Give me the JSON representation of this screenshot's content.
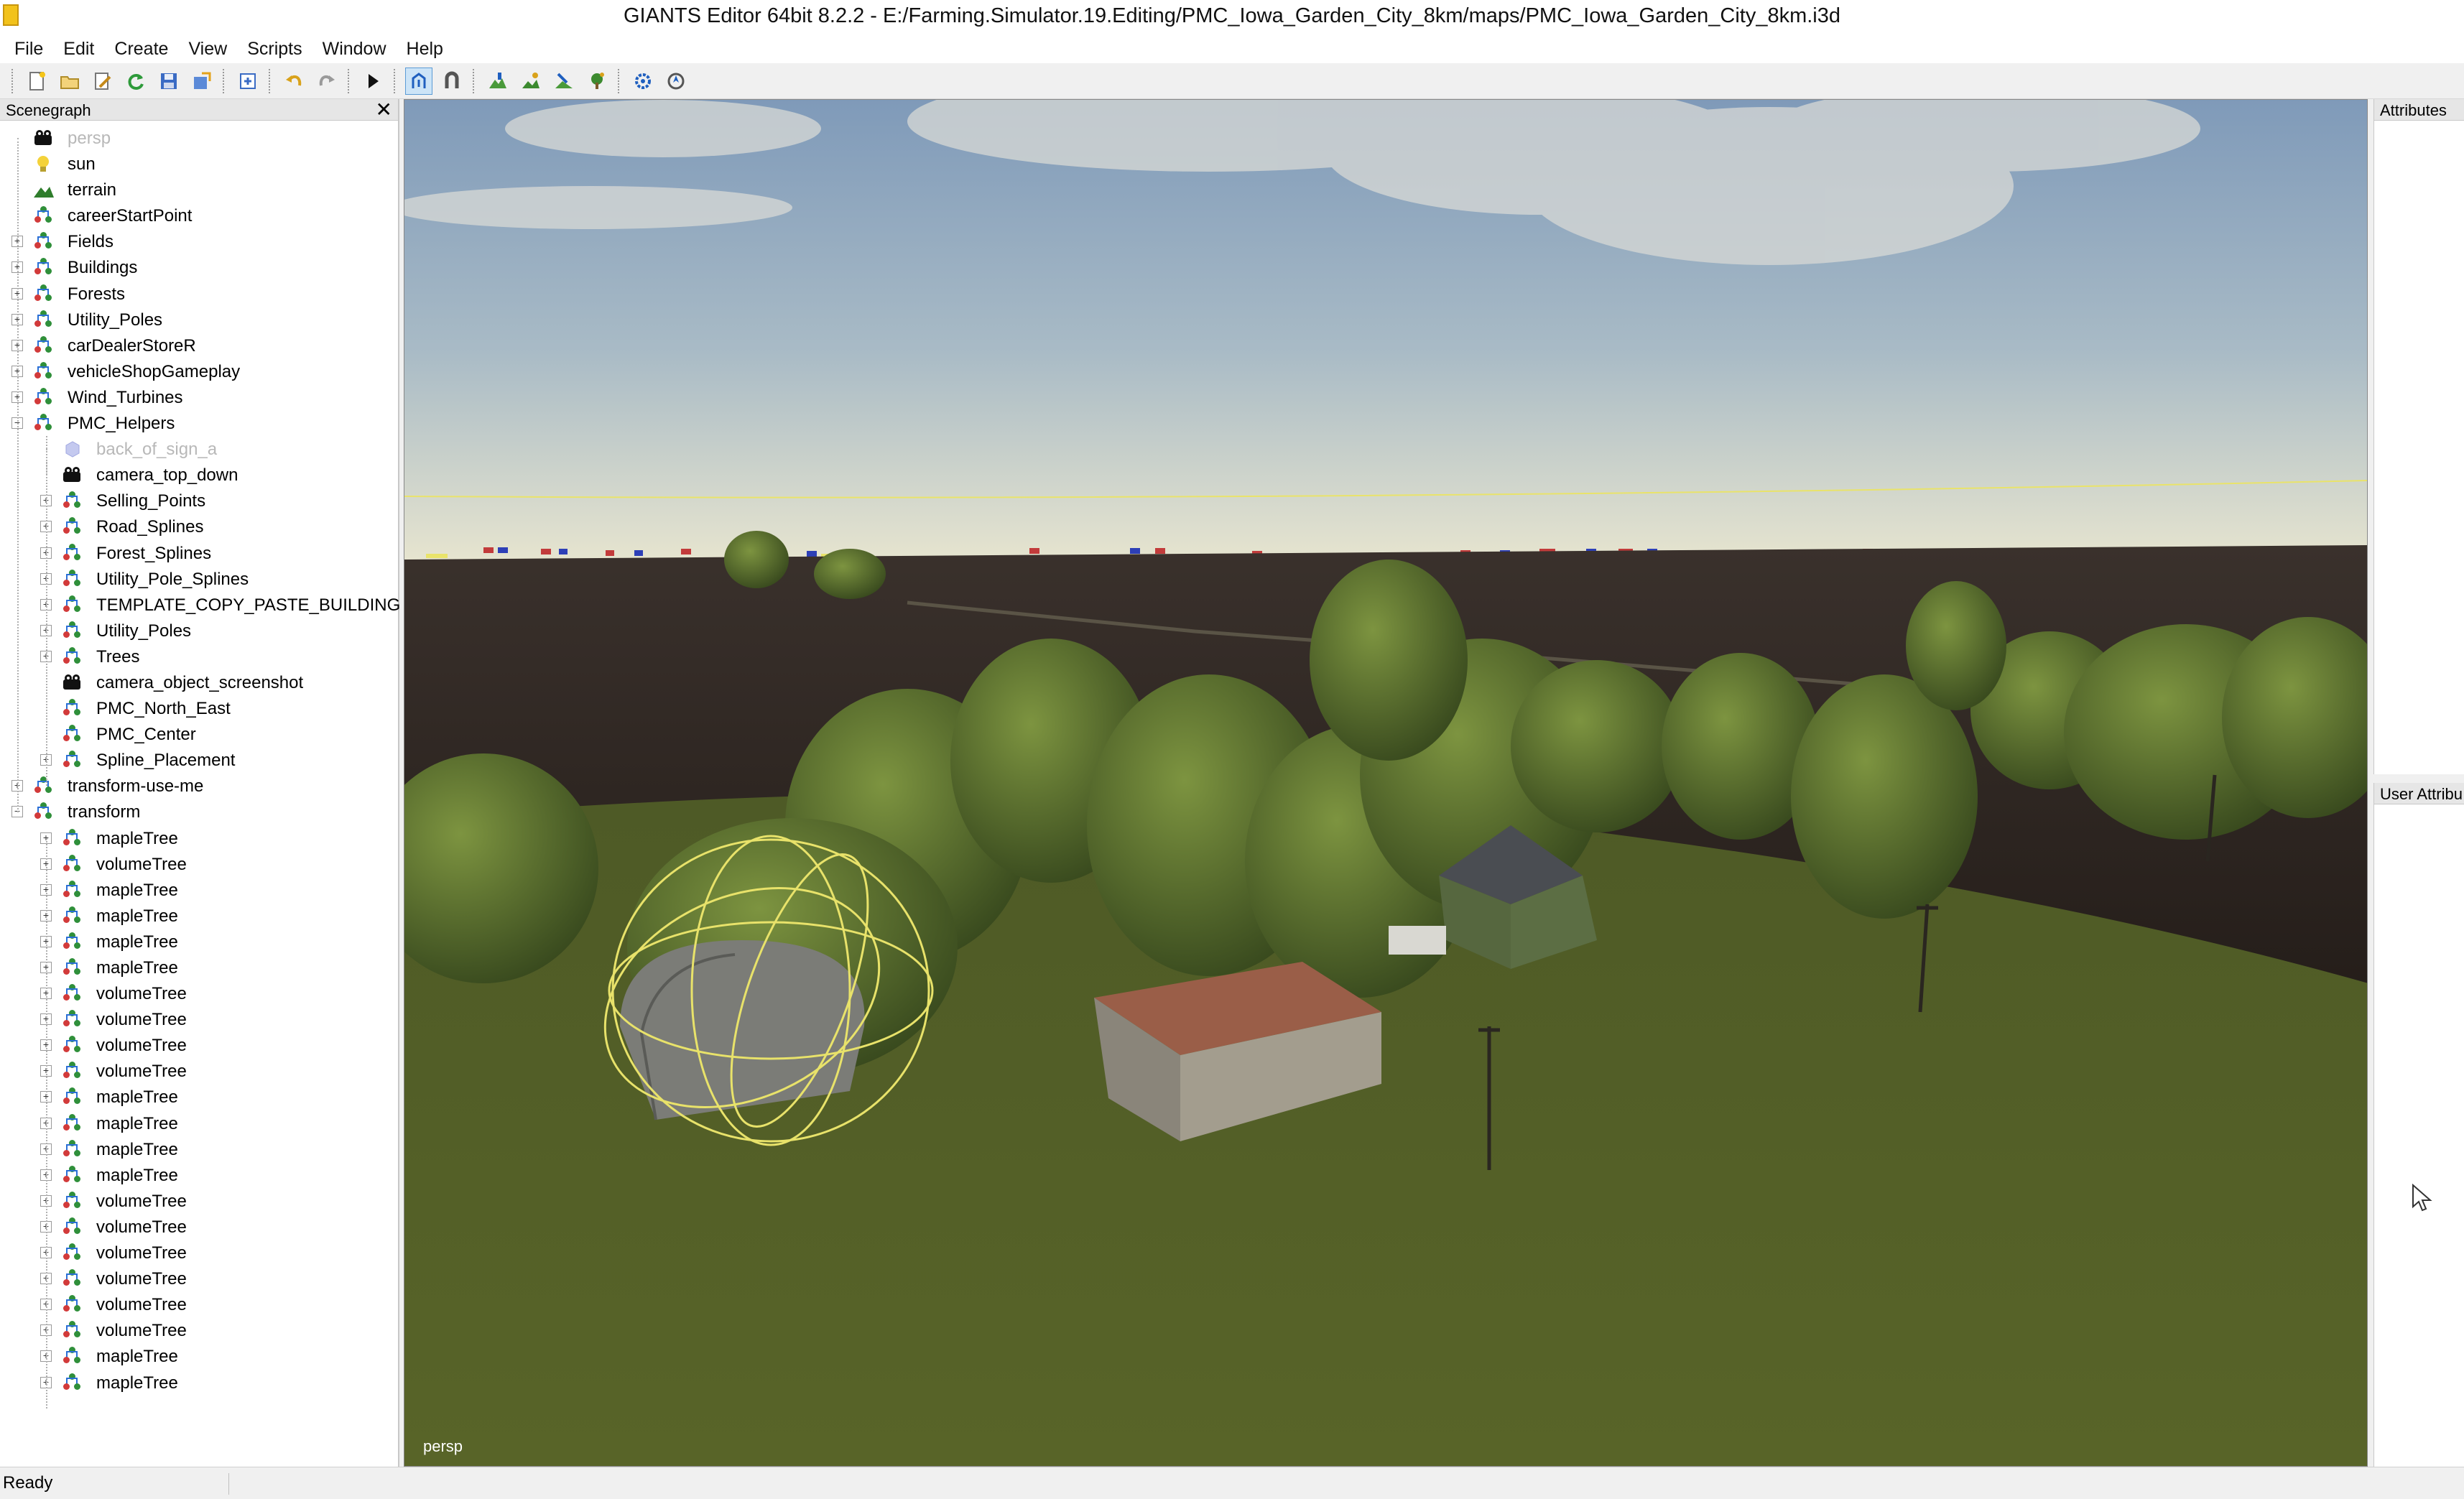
{
  "window": {
    "title": "GIANTS Editor 64bit 8.2.2 - E:/Farming.Simulator.19.Editing/PMC_Iowa_Garden_City_8km/maps/PMC_Iowa_Garden_City_8km.i3d"
  },
  "menu": [
    "File",
    "Edit",
    "Create",
    "View",
    "Scripts",
    "Window",
    "Help"
  ],
  "toolbar": {
    "icons": [
      "new-file-icon",
      "open-folder-icon",
      "edit-icon",
      "reload-icon",
      "save-icon",
      "export-icon",
      "import-icon",
      "undo-icon",
      "redo-icon",
      "play-icon",
      "select-mode-icon",
      "magnet-icon",
      "terrain-tool-icon",
      "foliage-paint-icon",
      "terrain-sculpt-icon",
      "tree-paint-icon",
      "settings-icon",
      "navigate-icon"
    ]
  },
  "scenegraph": {
    "title": "Scenegraph",
    "close": "✕",
    "nodes": [
      {
        "label": "persp",
        "icon": "camera-icon",
        "depth": 0,
        "expander": "",
        "dim": true
      },
      {
        "label": "sun",
        "icon": "light-bulb-icon",
        "depth": 0,
        "expander": ""
      },
      {
        "label": "terrain",
        "icon": "terrain-icon",
        "depth": 0,
        "expander": ""
      },
      {
        "label": "careerStartPoint",
        "icon": "transform-group-icon",
        "depth": 0,
        "expander": ""
      },
      {
        "label": "Fields",
        "icon": "transform-group-icon",
        "depth": 0,
        "expander": "+"
      },
      {
        "label": "Buildings",
        "icon": "transform-group-icon",
        "depth": 0,
        "expander": "+"
      },
      {
        "label": "Forests",
        "icon": "transform-group-icon",
        "depth": 0,
        "expander": "+"
      },
      {
        "label": "Utility_Poles",
        "icon": "transform-group-icon",
        "depth": 0,
        "expander": "+"
      },
      {
        "label": "carDealerStoreR",
        "icon": "transform-group-icon",
        "depth": 0,
        "expander": "+"
      },
      {
        "label": "vehicleShopGameplay",
        "icon": "transform-group-icon",
        "depth": 0,
        "expander": "+"
      },
      {
        "label": "Wind_Turbines",
        "icon": "transform-group-icon",
        "depth": 0,
        "expander": "+"
      },
      {
        "label": "PMC_Helpers",
        "icon": "transform-group-icon",
        "depth": 0,
        "expander": "−"
      },
      {
        "label": "back_of_sign_a",
        "icon": "shape-icon",
        "depth": 1,
        "expander": "",
        "dim": true
      },
      {
        "label": "camera_top_down",
        "icon": "camera-icon",
        "depth": 1,
        "expander": ""
      },
      {
        "label": "Selling_Points",
        "icon": "transform-group-icon",
        "depth": 1,
        "expander": "+"
      },
      {
        "label": "Road_Splines",
        "icon": "transform-group-icon",
        "depth": 1,
        "expander": "+"
      },
      {
        "label": "Forest_Splines",
        "icon": "transform-group-icon",
        "depth": 1,
        "expander": "+"
      },
      {
        "label": "Utility_Pole_Splines",
        "icon": "transform-group-icon",
        "depth": 1,
        "expander": "+"
      },
      {
        "label": "TEMPLATE_COPY_PASTE_BUILDING",
        "icon": "transform-group-icon",
        "depth": 1,
        "expander": "+"
      },
      {
        "label": "Utility_Poles",
        "icon": "transform-group-icon",
        "depth": 1,
        "expander": "+"
      },
      {
        "label": "Trees",
        "icon": "transform-group-icon",
        "depth": 1,
        "expander": "+"
      },
      {
        "label": "camera_object_screenshot",
        "icon": "camera-icon",
        "depth": 1,
        "expander": ""
      },
      {
        "label": "PMC_North_East",
        "icon": "transform-group-icon",
        "depth": 1,
        "expander": ""
      },
      {
        "label": "PMC_Center",
        "icon": "transform-group-icon",
        "depth": 1,
        "expander": ""
      },
      {
        "label": "Spline_Placement",
        "icon": "transform-group-icon",
        "depth": 1,
        "expander": "+"
      },
      {
        "label": "transform-use-me",
        "icon": "transform-group-icon",
        "depth": 0,
        "expander": "+"
      },
      {
        "label": "transform",
        "icon": "transform-group-icon",
        "depth": 0,
        "expander": "−"
      },
      {
        "label": "mapleTree",
        "icon": "transform-group-icon",
        "depth": 1,
        "expander": "+"
      },
      {
        "label": "volumeTree",
        "icon": "transform-group-icon",
        "depth": 1,
        "expander": "+"
      },
      {
        "label": "mapleTree",
        "icon": "transform-group-icon",
        "depth": 1,
        "expander": "+"
      },
      {
        "label": "mapleTree",
        "icon": "transform-group-icon",
        "depth": 1,
        "expander": "+"
      },
      {
        "label": "mapleTree",
        "icon": "transform-group-icon",
        "depth": 1,
        "expander": "+"
      },
      {
        "label": "mapleTree",
        "icon": "transform-group-icon",
        "depth": 1,
        "expander": "+"
      },
      {
        "label": "volumeTree",
        "icon": "transform-group-icon",
        "depth": 1,
        "expander": "+"
      },
      {
        "label": "volumeTree",
        "icon": "transform-group-icon",
        "depth": 1,
        "expander": "+"
      },
      {
        "label": "volumeTree",
        "icon": "transform-group-icon",
        "depth": 1,
        "expander": "+"
      },
      {
        "label": "volumeTree",
        "icon": "transform-group-icon",
        "depth": 1,
        "expander": "+"
      },
      {
        "label": "mapleTree",
        "icon": "transform-group-icon",
        "depth": 1,
        "expander": "+"
      },
      {
        "label": "mapleTree",
        "icon": "transform-group-icon",
        "depth": 1,
        "expander": "+"
      },
      {
        "label": "mapleTree",
        "icon": "transform-group-icon",
        "depth": 1,
        "expander": "+"
      },
      {
        "label": "mapleTree",
        "icon": "transform-group-icon",
        "depth": 1,
        "expander": "+"
      },
      {
        "label": "volumeTree",
        "icon": "transform-group-icon",
        "depth": 1,
        "expander": "+"
      },
      {
        "label": "volumeTree",
        "icon": "transform-group-icon",
        "depth": 1,
        "expander": "+"
      },
      {
        "label": "volumeTree",
        "icon": "transform-group-icon",
        "depth": 1,
        "expander": "+"
      },
      {
        "label": "volumeTree",
        "icon": "transform-group-icon",
        "depth": 1,
        "expander": "+"
      },
      {
        "label": "volumeTree",
        "icon": "transform-group-icon",
        "depth": 1,
        "expander": "+"
      },
      {
        "label": "volumeTree",
        "icon": "transform-group-icon",
        "depth": 1,
        "expander": "+"
      },
      {
        "label": "mapleTree",
        "icon": "transform-group-icon",
        "depth": 1,
        "expander": "+"
      },
      {
        "label": "mapleTree",
        "icon": "transform-group-icon",
        "depth": 1,
        "expander": "+"
      }
    ]
  },
  "viewport": {
    "camera_label": "persp"
  },
  "attributes": {
    "title": "Attributes"
  },
  "user_attributes": {
    "title": "User Attribu"
  },
  "status": {
    "text": "Ready"
  },
  "colors": {
    "sky_top": "#7d98b8",
    "sky_horizon": "#e4e3cf",
    "field_dark": "#2c2521",
    "grass": "#4f5a24",
    "gizmo": "#e8e26a",
    "selection_blue": "#cce4f7"
  }
}
